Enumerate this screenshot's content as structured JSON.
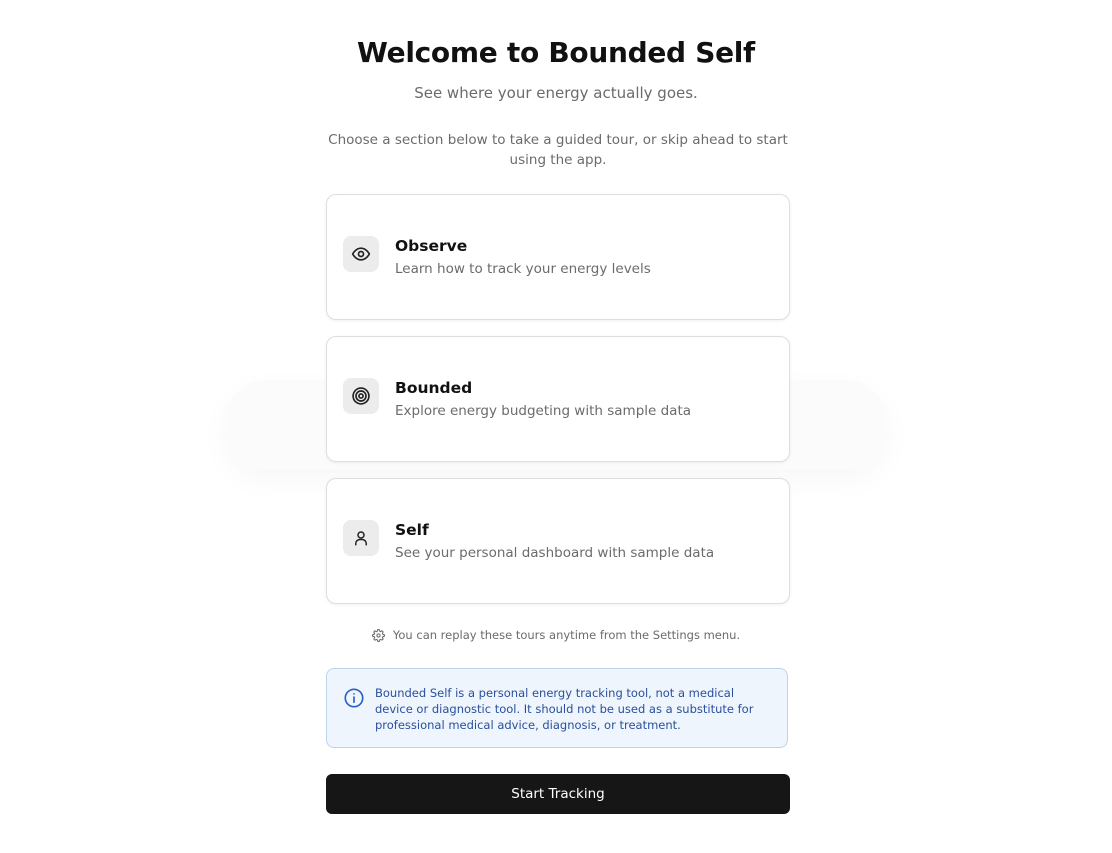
{
  "header": {
    "title": "Welcome to Bounded Self",
    "subtitle": "See where your energy actually goes.",
    "instructions": "Choose a section below to take a guided tour, or skip ahead to start using the app."
  },
  "sections": [
    {
      "icon": "eye-icon",
      "title": "Observe",
      "description": "Learn how to track your energy levels"
    },
    {
      "icon": "target-icon",
      "title": "Bounded",
      "description": "Explore energy budgeting with sample data"
    },
    {
      "icon": "user-icon",
      "title": "Self",
      "description": "See your personal dashboard with sample data"
    }
  ],
  "replay_note": {
    "icon": "gear-icon",
    "text": "You can replay these tours anytime from the Settings menu."
  },
  "disclaimer": {
    "icon": "info-icon",
    "text": "Bounded Self is a personal energy tracking tool, not a medical device or diagnostic tool. It should not be used as a substitute for professional medical advice, diagnosis, or treatment."
  },
  "actions": {
    "start_label": "Start Tracking"
  },
  "colors": {
    "primary_button": "#161616",
    "info_background": "#eff5fd",
    "info_border": "#bcd3f0",
    "info_text": "#2a4f9c"
  }
}
